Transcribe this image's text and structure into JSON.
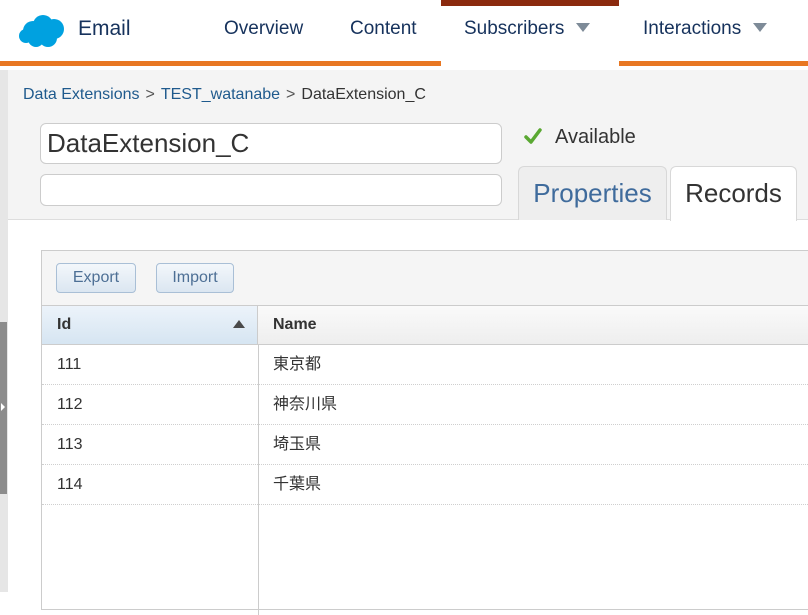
{
  "app": {
    "title": "Email",
    "brand_color": "#00a1e0",
    "accent_color": "#e87722"
  },
  "nav": {
    "overview": "Overview",
    "content": "Content",
    "subscribers": "Subscribers",
    "interactions": "Interactions",
    "active": "Subscribers"
  },
  "breadcrumb": {
    "level1": "Data Extensions",
    "level2": "TEST_watanabe",
    "current": "DataExtension_C",
    "separator": ">"
  },
  "form": {
    "name_value": "DataExtension_C",
    "description_value": ""
  },
  "status": {
    "icon": "check-icon",
    "text": "Available",
    "color": "#5aa832"
  },
  "tabs": {
    "properties": "Properties",
    "records": "Records",
    "active": "Records"
  },
  "toolbar": {
    "export_label": "Export",
    "import_label": "Import"
  },
  "table": {
    "columns": [
      {
        "label": "Id",
        "sorted": "ascending"
      },
      {
        "label": "Name"
      }
    ],
    "rows": [
      {
        "id": "111",
        "name": "東京都"
      },
      {
        "id": "112",
        "name": "神奈川県"
      },
      {
        "id": "113",
        "name": "埼玉県"
      },
      {
        "id": "114",
        "name": "千葉県"
      }
    ]
  }
}
